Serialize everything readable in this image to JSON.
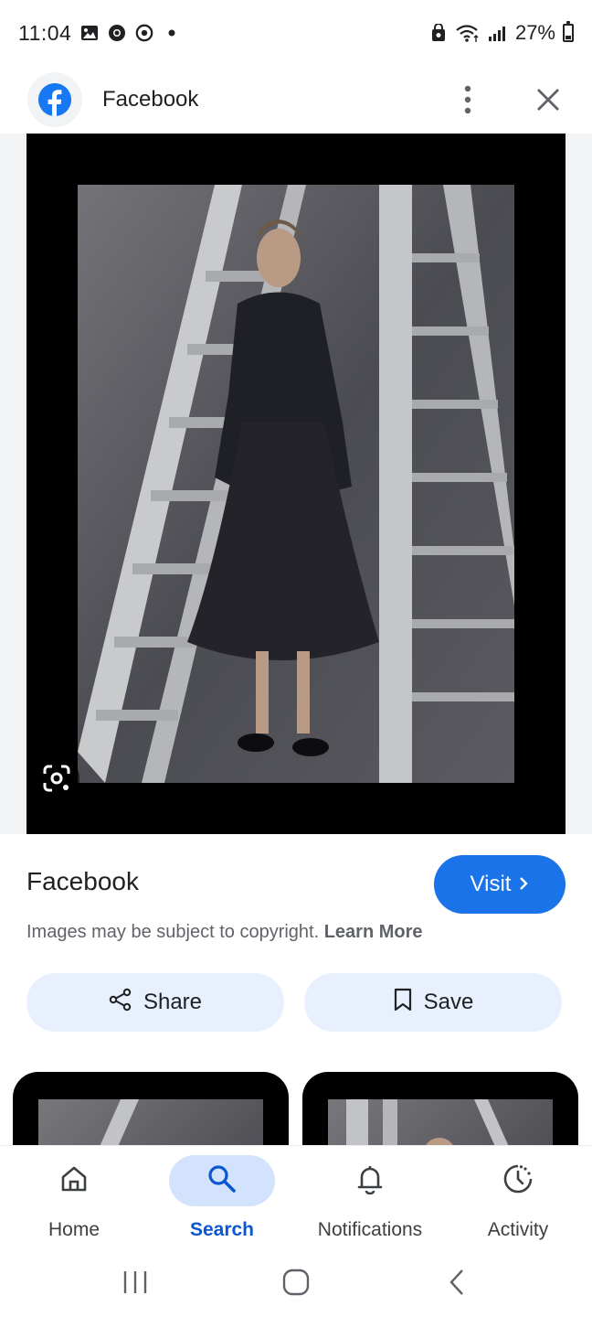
{
  "status_bar": {
    "time": "11:04",
    "battery": "27%",
    "battery_level": 0.27,
    "left_icons": [
      "gallery-icon",
      "chrome-icon",
      "chrome-alt-icon",
      "dot-icon"
    ],
    "right_icons": [
      "recycle-lock-icon",
      "wifi-icon",
      "signal-icon",
      "battery-icon"
    ]
  },
  "header": {
    "title": "Facebook",
    "logo_icon": "facebook-icon",
    "menu_icon": "more-vert-icon",
    "close_icon": "close-icon"
  },
  "image": {
    "lens_icon": "google-lens-icon"
  },
  "info": {
    "source_title": "Facebook",
    "visit_label": "Visit",
    "copyright_text": "Images may be subject to copyright. ",
    "learn_more_label": "Learn More",
    "share_label": "Share",
    "save_label": "Save"
  },
  "bottom_nav": {
    "items": [
      {
        "label": "Home",
        "icon": "home-icon",
        "active": false
      },
      {
        "label": "Search",
        "icon": "search-icon",
        "active": true
      },
      {
        "label": "Notifications",
        "icon": "bell-icon",
        "active": false
      },
      {
        "label": "Activity",
        "icon": "activity-icon",
        "active": false
      }
    ]
  },
  "system_nav": {
    "icons": [
      "recents-icon",
      "home-circle-icon",
      "back-icon"
    ]
  },
  "colors": {
    "accent": "#1a73e8",
    "chip_bg": "#e8f0fe",
    "facebook_blue": "#1877f2",
    "active_nav": "#0b57d0"
  }
}
